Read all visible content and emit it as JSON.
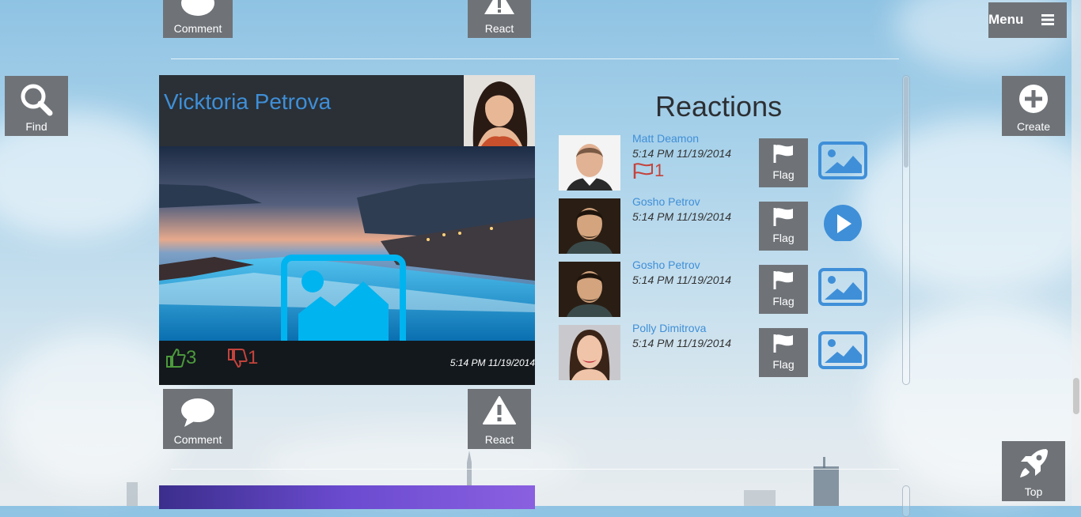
{
  "top_actions": {
    "comment_label": "Comment",
    "react_label": "React"
  },
  "side": {
    "find_label": "Find",
    "create_label": "Create",
    "top_label": "Top",
    "menu_label": "Menu"
  },
  "post": {
    "author": "Vicktoria Petrova",
    "likes": "3",
    "dislikes": "1",
    "time": "5:14 PM 11/19/2014",
    "comment_label": "Comment",
    "react_label": "React"
  },
  "reactions": {
    "title": "Reactions",
    "flag_label": "Flag",
    "items": [
      {
        "name": "Matt Deamon",
        "time": "5:14 PM 11/19/2014",
        "flags": "1",
        "media": "image-icon"
      },
      {
        "name": "Gosho Petrov",
        "time": "5:14 PM 11/19/2014",
        "flags": "",
        "media": "play-icon"
      },
      {
        "name": "Gosho Petrov",
        "time": "5:14 PM 11/19/2014",
        "flags": "",
        "media": "image-icon"
      },
      {
        "name": "Polly Dimitrova",
        "time": "5:14 PM 11/19/2014",
        "flags": "",
        "media": "image-icon"
      }
    ]
  },
  "colors": {
    "tile": "#6f7378",
    "link": "#3f8fd8",
    "like": "#4c9a3c",
    "dislike": "#c4433c",
    "media": "#3f8fd8"
  }
}
